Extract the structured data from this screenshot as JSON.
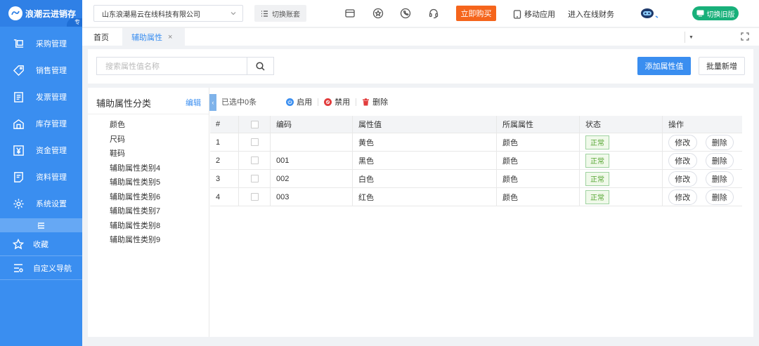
{
  "brand": {
    "name": "浪潮云进销存",
    "tag": "专"
  },
  "sidebar": {
    "items": [
      {
        "label": "采购管理",
        "icon": "cart-icon"
      },
      {
        "label": "销售管理",
        "icon": "tag-icon"
      },
      {
        "label": "发票管理",
        "icon": "invoice-icon"
      },
      {
        "label": "库存管理",
        "icon": "warehouse-icon"
      },
      {
        "label": "资金管理",
        "icon": "yuan-icon"
      },
      {
        "label": "资料管理",
        "icon": "document-icon"
      },
      {
        "label": "系统设置",
        "icon": "gear-icon"
      }
    ],
    "favorites": "收藏",
    "custom_nav": "自定义导航"
  },
  "header": {
    "company": "山东浪潮易云在线科技有限公司",
    "switch_account": "切换账套",
    "buy_now": "立即购买",
    "mobile_app": "移动应用",
    "finance": "进入在线财务",
    "switch_old": "切换旧版"
  },
  "tabs": {
    "home": "首页",
    "active": "辅助属性",
    "close": "×"
  },
  "search": {
    "placeholder": "搜索属性值名称",
    "add_button": "添加属性值",
    "batch_button": "批量新增"
  },
  "category": {
    "title": "辅助属性分类",
    "edit": "编辑",
    "items": [
      "颜色",
      "尺码",
      "鞋码",
      "辅助属性类别4",
      "辅助属性类别5",
      "辅助属性类别6",
      "辅助属性类别7",
      "辅助属性类别8",
      "辅助属性类别9"
    ]
  },
  "toolbar": {
    "selected": "已选中0条",
    "enable": "启用",
    "disable": "禁用",
    "delete": "删除"
  },
  "table": {
    "headers": [
      "#",
      "",
      "编码",
      "属性值",
      "所属属性",
      "状态",
      "操作"
    ],
    "rows": [
      {
        "num": "1",
        "code": "",
        "value": "黄色",
        "attr": "颜色",
        "status": "正常"
      },
      {
        "num": "2",
        "code": "001",
        "value": "黑色",
        "attr": "颜色",
        "status": "正常"
      },
      {
        "num": "3",
        "code": "002",
        "value": "白色",
        "attr": "颜色",
        "status": "正常"
      },
      {
        "num": "4",
        "code": "003",
        "value": "红色",
        "attr": "颜色",
        "status": "正常"
      }
    ],
    "edit_label": "修改",
    "delete_label": "删除"
  },
  "colors": {
    "primary": "#3a8ef0",
    "buy": "#f5651c",
    "switch_old": "#18b07a",
    "status_text": "#55a532"
  }
}
